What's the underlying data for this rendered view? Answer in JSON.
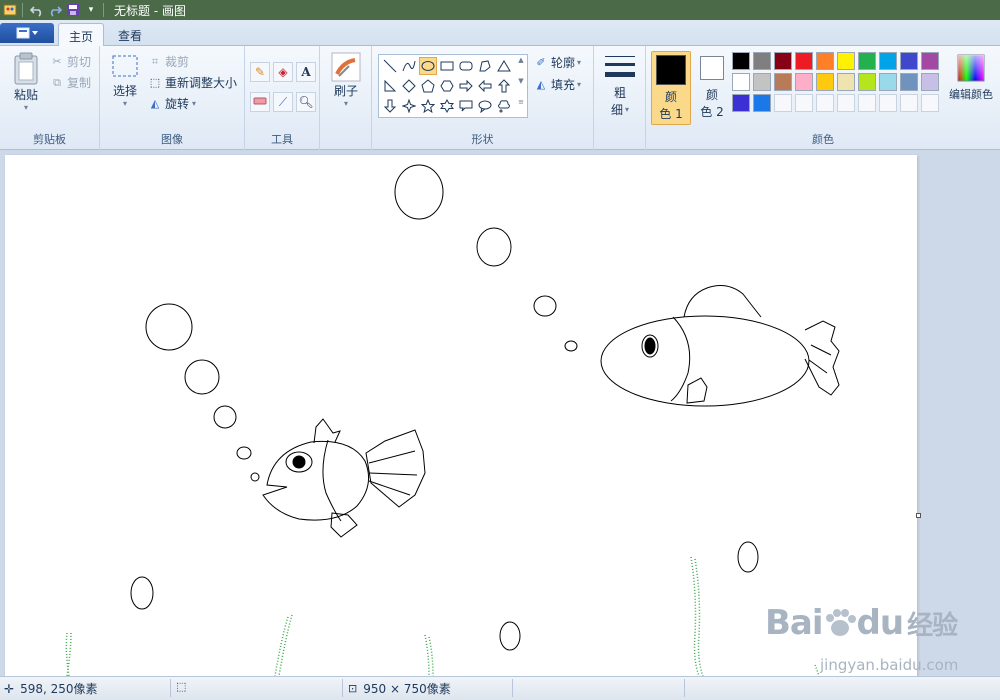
{
  "window": {
    "title": "无标题 - 画图"
  },
  "tabs": [
    {
      "label": "主页"
    },
    {
      "label": "查看"
    }
  ],
  "clipboard": {
    "paste": "粘贴",
    "cut": "剪切",
    "copy": "复制",
    "group": "剪贴板"
  },
  "image": {
    "select": "选择",
    "crop": "裁剪",
    "resize": "重新调整大小",
    "rotate": "旋转",
    "group": "图像"
  },
  "tools": {
    "group": "工具"
  },
  "brushes": {
    "label": "刷子"
  },
  "shapes": {
    "outline": "轮廓",
    "fill": "填充",
    "group": "形状"
  },
  "size": {
    "label_line1": "粗",
    "label_line2": "细"
  },
  "colors": {
    "color1_line1": "颜",
    "color1_line2": "色 1",
    "color2_line1": "颜",
    "color2_line2": "色 2",
    "edit": "编辑颜色",
    "group": "颜色",
    "palette_row1": [
      "#000000",
      "#7f7f7f",
      "#880015",
      "#ed1c24",
      "#ff7f27",
      "#fff200",
      "#22b14c",
      "#00a2e8",
      "#3f48cc",
      "#a349a4"
    ],
    "palette_row2": [
      "#ffffff",
      "#c3c3c3",
      "#b97a57",
      "#ffaec9",
      "#ffc90e",
      "#efe4b0",
      "#b5e61d",
      "#99d9ea",
      "#7092be",
      "#c8bfe7"
    ],
    "palette_row3": [
      "#3c2fd6",
      "#1a78e8"
    ]
  },
  "status": {
    "cursor_pos": "598, 250像素",
    "canvas_size": "950 × 750像素"
  },
  "watermark": {
    "brand": "Bai",
    "brand2": "du",
    "cn": "经验",
    "url": "jingyan.baidu.com"
  }
}
